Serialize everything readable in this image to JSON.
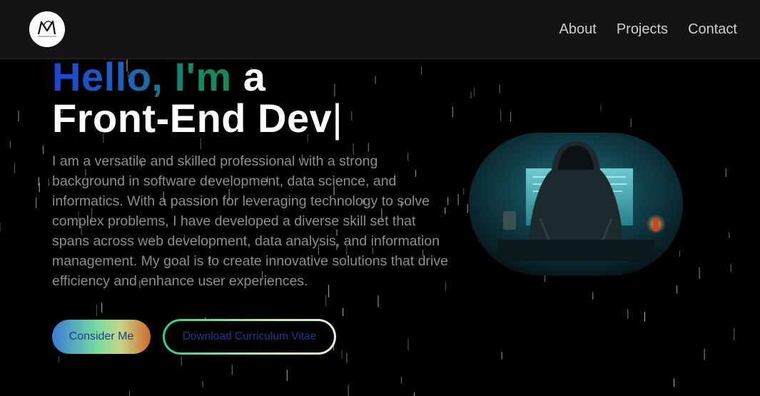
{
  "nav": {
    "logo_label": "logo",
    "links": [
      "About",
      "Projects",
      "Contact"
    ]
  },
  "hero": {
    "greeting": "Hello, I'm",
    "article": "a",
    "role": "Front-End Dev",
    "cursor": "|",
    "intro": "I am a versatile and skilled professional with a strong background in software development, data science, and informatics. With a passion for leveraging technology to solve complex problems, I have developed a diverse skill set that spans across web development, data analysis, and information management. My goal is to create innovative solutions that drive efficiency and enhance user experiences."
  },
  "buttons": {
    "consider": "Consider Me",
    "download_cv": "Download Curriculum Vitae"
  },
  "colors": {
    "background": "#000000",
    "navbar": "#141414",
    "accent_blue": "#1f44d8",
    "accent_green": "#138a58",
    "button_text": "#1e3a8a",
    "body_text": "#8d8d8d"
  }
}
